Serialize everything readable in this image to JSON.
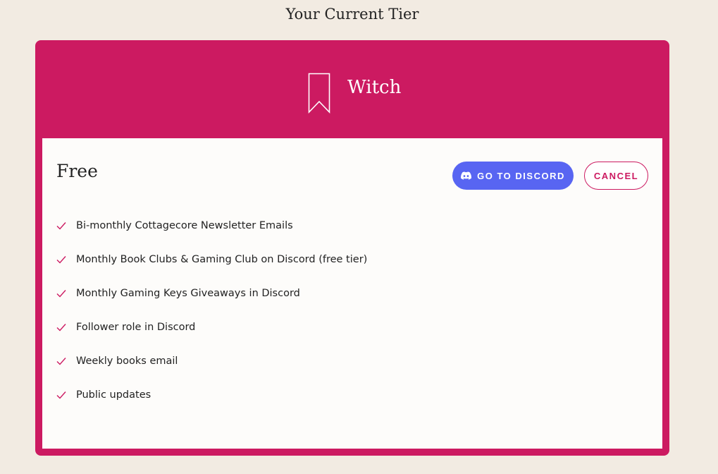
{
  "page": {
    "heading": "Your Current Tier"
  },
  "tier": {
    "name": "Witch",
    "icon": "bookmark-icon",
    "price": "Free"
  },
  "actions": {
    "discord_label": "GO TO DISCORD",
    "discord_icon": "discord-icon",
    "cancel_label": "CANCEL"
  },
  "features": [
    "Bi-monthly Cottagecore Newsletter Emails",
    "Monthly Book Clubs & Gaming Club on Discord (free tier)",
    "Monthly Gaming Keys Giveaways in Discord",
    "Follower role in Discord",
    "Weekly books email",
    "Public updates"
  ],
  "colors": {
    "page_background": "#f2ebe2",
    "accent": "#cc1a61",
    "discord": "#5865f2",
    "card_body": "#fdfcfa"
  }
}
